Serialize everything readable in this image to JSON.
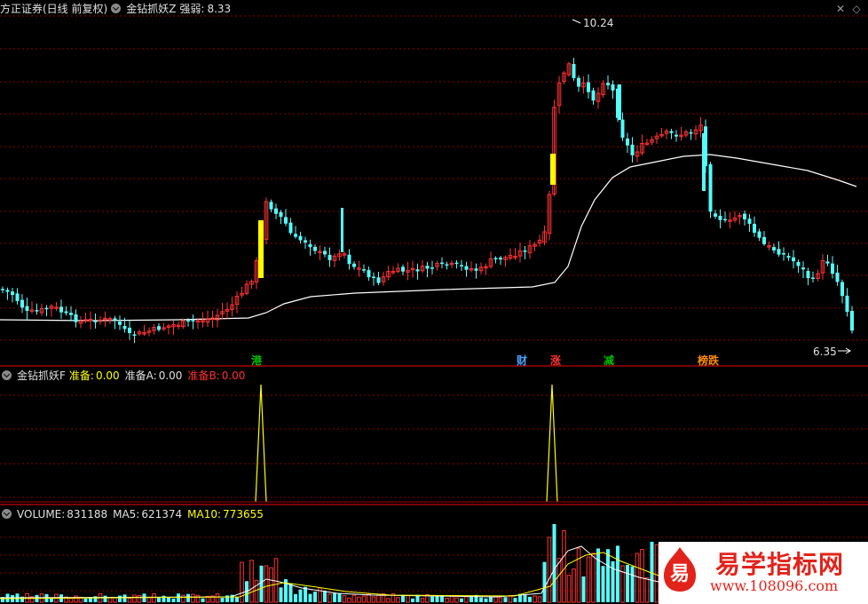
{
  "header": {
    "title": "方正证券(日线 前复权)",
    "indicator_name": "金钻抓妖Z",
    "strength_label": "强弱:",
    "strength_value": "8.33"
  },
  "price_panel": {
    "high_label": "10.24",
    "low_label": "6.35"
  },
  "signals": [
    {
      "label": "港",
      "color": "#00c000"
    },
    {
      "label": "财",
      "color": "#4aa3ff"
    },
    {
      "label": "涨",
      "color": "#ff3030"
    },
    {
      "label": "减",
      "color": "#00c000"
    },
    {
      "label": "榜跌",
      "color": "#ff8c00"
    }
  ],
  "indicator_panel": {
    "name": "金钻抓妖F",
    "ready_label": "准备:",
    "ready_value": "0.00",
    "ready_a_label": "准备A:",
    "ready_a_value": "0.00",
    "ready_b_label": "准备B:",
    "ready_b_value": "0.00"
  },
  "volume_panel": {
    "volume_label": "VOLUME:",
    "volume_value": "831188",
    "ma5_label": "MA5:",
    "ma5_value": "621374",
    "ma10_label": "MA10:",
    "ma10_value": "773655"
  },
  "watermark": {
    "logo_char": "易",
    "title": "易学指标网",
    "url": "www.108096.com"
  },
  "colors": {
    "up": "#ff3232",
    "down": "#54fcfc",
    "ma_line": "#ffffff",
    "yellow": "#ffff00",
    "gridline": "#8b0000",
    "separator": "#a00000",
    "ma5": "#ffffff",
    "ma10": "#ffff00"
  }
}
